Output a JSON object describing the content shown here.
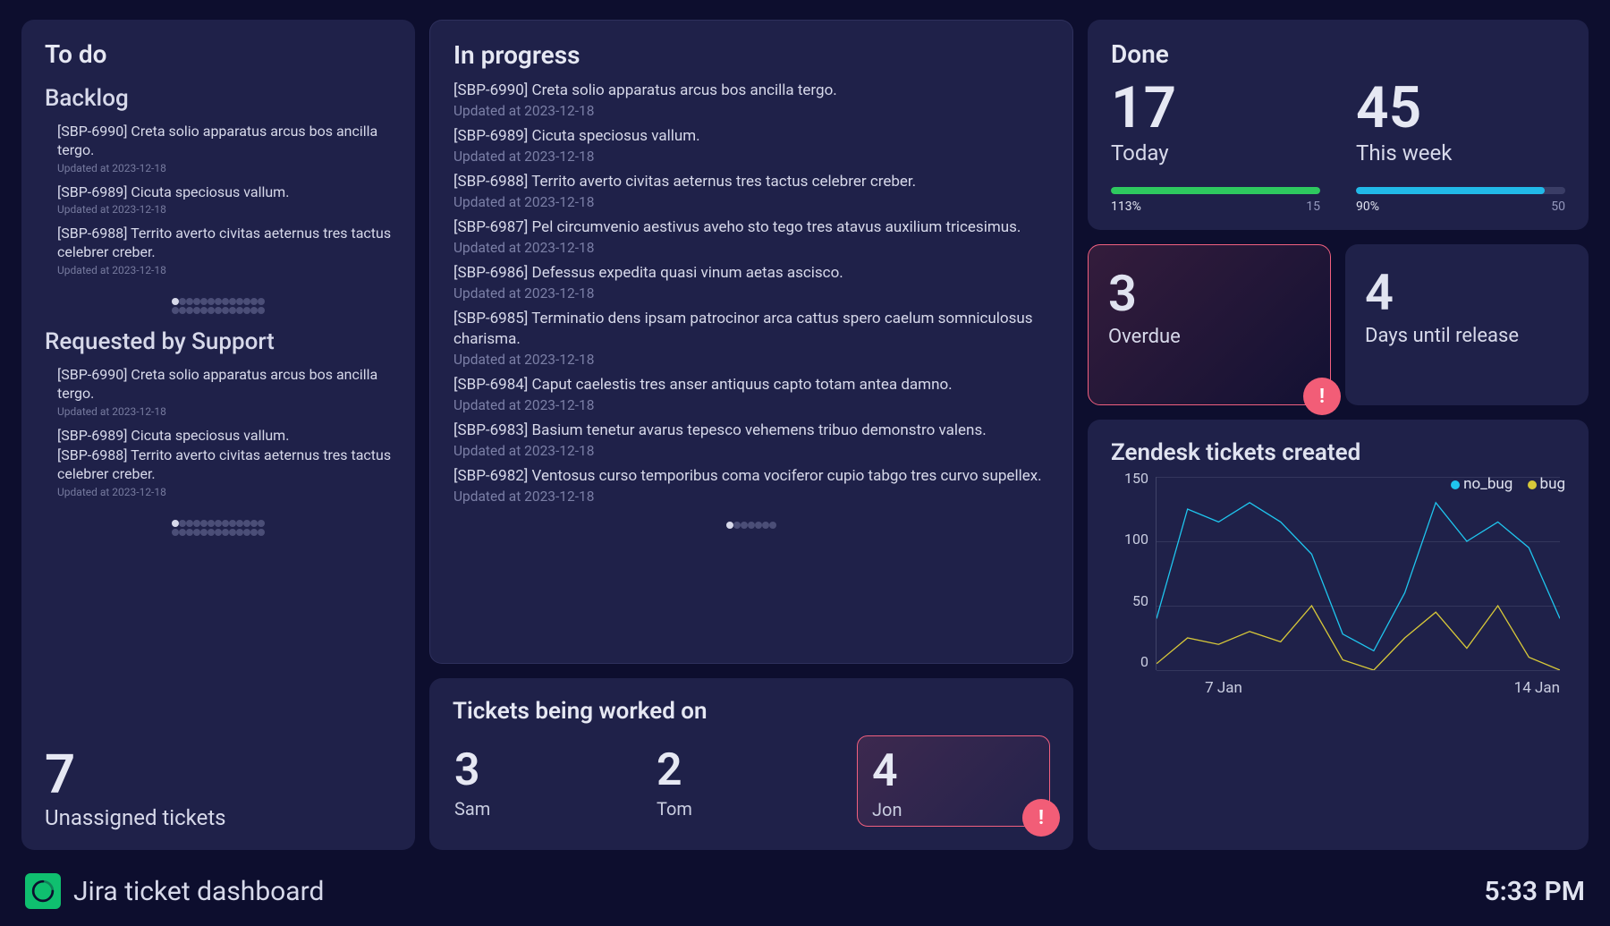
{
  "todo": {
    "title": "To do",
    "backlog_title": "Backlog",
    "backlog_items": [
      {
        "title": "[SBP-6990] Creta solio apparatus arcus bos ancilla tergo.",
        "meta": "Updated at 2023-12-18"
      },
      {
        "title": "[SBP-6989] Cicuta speciosus vallum.",
        "meta": "Updated at 2023-12-18"
      },
      {
        "title": "[SBP-6988] Territo averto civitas aeternus tres tactus celebrer creber.",
        "meta": "Updated at 2023-12-18"
      }
    ],
    "backlog_pages": {
      "total": 26,
      "active": 0,
      "row_size": 13
    },
    "support_title": "Requested by Support",
    "support_items": [
      {
        "title": "[SBP-6990] Creta solio apparatus arcus bos ancilla tergo.",
        "meta": "Updated at 2023-12-18"
      },
      {
        "title": "[SBP-6989] Cicuta speciosus vallum.",
        "meta": ""
      },
      {
        "title": "[SBP-6988] Territo averto civitas aeternus tres tactus celebrer creber.",
        "meta": "Updated at 2023-12-18"
      }
    ],
    "support_pages": {
      "total": 26,
      "active": 0,
      "row_size": 13
    },
    "unassigned_value": "7",
    "unassigned_label": "Unassigned tickets"
  },
  "inprogress": {
    "title": "In progress",
    "items": [
      {
        "title": "[SBP-6990] Creta solio apparatus arcus bos ancilla tergo.",
        "meta": "Updated at 2023-12-18"
      },
      {
        "title": "[SBP-6989] Cicuta speciosus vallum.",
        "meta": "Updated at 2023-12-18"
      },
      {
        "title": "[SBP-6988] Territo averto civitas aeternus tres tactus celebrer creber.",
        "meta": "Updated at 2023-12-18"
      },
      {
        "title": "[SBP-6987] Pel circumvenio aestivus aveho sto tego tres atavus auxilium tricesimus.",
        "meta": "Updated at 2023-12-18"
      },
      {
        "title": "[SBP-6986] Defessus expedita quasi vinum aetas ascisco.",
        "meta": "Updated at 2023-12-18"
      },
      {
        "title": "[SBP-6985] Terminatio dens ipsam patrocinor arca cattus spero caelum somniculosus charisma.",
        "meta": "Updated at 2023-12-18"
      },
      {
        "title": "[SBP-6984] Caput caelestis tres anser antiquus capto totam antea damno.",
        "meta": "Updated at 2023-12-18"
      },
      {
        "title": "[SBP-6983] Basium tenetur avarus tepesco vehemens tribuo demonstro valens.",
        "meta": "Updated at 2023-12-18"
      },
      {
        "title": "[SBP-6982] Ventosus curso temporibus coma vociferor cupio tabgo tres curvo supellex.",
        "meta": "Updated at 2023-12-18"
      }
    ],
    "pages": {
      "total": 7,
      "active": 0
    }
  },
  "workers": {
    "title": "Tickets being worked on",
    "people": [
      {
        "name": "Sam",
        "count": "3",
        "alert": false
      },
      {
        "name": "Tom",
        "count": "2",
        "alert": false
      },
      {
        "name": "Jon",
        "count": "4",
        "alert": true
      }
    ]
  },
  "done": {
    "title": "Done",
    "today_value": "17",
    "today_label": "Today",
    "today_pct_label": "113%",
    "today_pct": 100,
    "today_target": "15",
    "week_value": "45",
    "week_label": "This week",
    "week_pct_label": "90%",
    "week_pct": 90,
    "week_target": "50"
  },
  "overdue": {
    "value": "3",
    "label": "Overdue"
  },
  "release": {
    "value": "4",
    "label": "Days until release"
  },
  "chart": {
    "title": "Zendesk tickets created",
    "legend": [
      {
        "name": "no_bug",
        "color": "blue"
      },
      {
        "name": "bug",
        "color": "yellow"
      }
    ],
    "ylabels": [
      "150",
      "100",
      "50",
      "0"
    ],
    "xlabels": [
      "7 Jan",
      "14 Jan"
    ]
  },
  "chart_data": {
    "type": "line",
    "title": "Zendesk tickets created",
    "xlabel": "",
    "ylabel": "",
    "ylim": [
      0,
      150
    ],
    "x": [
      1,
      2,
      3,
      4,
      5,
      6,
      7,
      8,
      9,
      10,
      11,
      12,
      13,
      14
    ],
    "x_tick_labels": {
      "7": "7 Jan",
      "14": "14 Jan"
    },
    "series": [
      {
        "name": "no_bug",
        "color": "#1fc5ee",
        "values": [
          40,
          125,
          115,
          130,
          115,
          90,
          28,
          15,
          60,
          130,
          100,
          115,
          95,
          40
        ]
      },
      {
        "name": "bug",
        "color": "#d7c839",
        "values": [
          5,
          25,
          20,
          30,
          22,
          50,
          8,
          0,
          25,
          45,
          17,
          50,
          10,
          0
        ]
      }
    ]
  },
  "footer": {
    "title": "Jira ticket dashboard",
    "time": "5:33 PM"
  }
}
